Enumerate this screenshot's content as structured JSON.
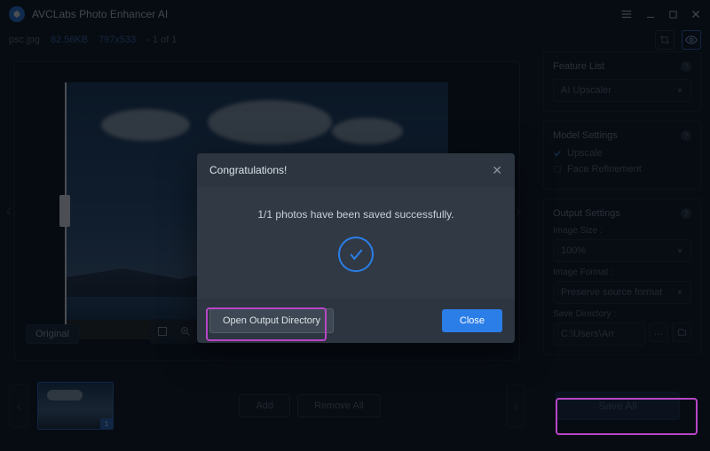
{
  "titlebar": {
    "app_name": "AVCLabs Photo Enhancer AI"
  },
  "infobar": {
    "filename": "psc.jpg",
    "filesize": "82.56KB",
    "dimensions": "797x533",
    "count": "- 1 of 1"
  },
  "viewer": {
    "original_label": "Original"
  },
  "sidebar": {
    "feature_list": {
      "title": "Feature List",
      "selected": "AI Upscaler"
    },
    "model_settings": {
      "title": "Model Settings",
      "opt_upscale": "Upscale",
      "opt_face": "Face Refinement"
    },
    "output_settings": {
      "title": "Output Settings",
      "image_size_label": "Image Size :",
      "image_size_value": "100%",
      "image_format_label": "Image Format :",
      "image_format_value": "Preserve source format",
      "save_dir_label": "Save Directory :",
      "save_dir_value": "C:\\Users\\Arr"
    }
  },
  "bottombar": {
    "thumb_badge": "1",
    "add": "Add",
    "remove_all": "Remove All",
    "save_all": "Save All"
  },
  "modal": {
    "title": "Congratulations!",
    "message": "1/1 photos have been saved successfully.",
    "open_dir": "Open Output Directory",
    "close": "Close"
  }
}
